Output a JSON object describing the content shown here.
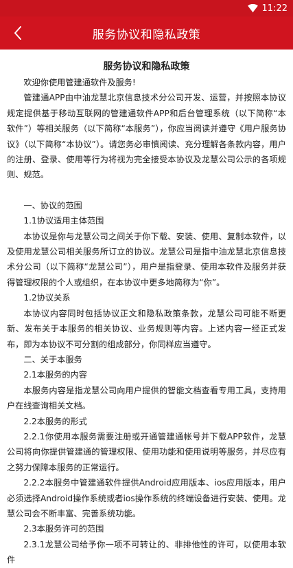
{
  "status_bar": {
    "time": "11:22"
  },
  "header": {
    "title": "服务协议和隐私政策"
  },
  "doc": {
    "title": "服务协议和隐私政策",
    "paragraphs": [
      "欢迎你使用管建通软件及服务!",
      "管建通APP由中油龙慧北京信息技术分公司开发、运营，并按照本协议规定提供基于移动互联网的管建通软件APP和后台管理系统（以下简称“本软件”）等相关服务（以下简称“本服务”），你应当阅读并遵守《用户服务协议》（以下简称“本协议”）。请您务必审慎阅读、充分理解各条款内容，用户的注册、登录、使用等行为将视为完全接受本协议及龙慧公司公示的各项规则、规范。",
      "一、协议的范围",
      "1.1协议适用主体范围",
      "本协议是你与龙慧公司之间关于你下载、安装、使用、复制本软件，以及使用龙慧公司相关服务所订立的协议。龙慧公司是指中油龙慧北京信息技术分公司（以下简称“龙慧公司”），用户是指登录、使用本软件及服务并获得管理权限的个人或组织，在本协议中更多地简称为“你”。",
      "1.2协议关系",
      "本协议内容同时包括协议正文和隐私政策条款，龙慧公司可能不断更新、发布关于本服务的相关协议、业务规则等内容。上述内容一经正式发布，即为本协议不可分割的组成部分，你同样应当遵守。",
      "二、关于本服务",
      "2.1本服务的内容",
      "本服务内容是指龙慧公司向用户提供的智能文档查看专用工具，支持用户在线查询相关文档。",
      "2.2本服务的形式",
      "2.2.1你使用本服务需要注册或开通管建通帐号并下载APP软件，龙慧公司将向你提供管建通的管理权限、使用功能和使用说明等服务，并尽应有之努力保障本服务的正常运行。",
      "2.2.2本服务中管建通软件提供Android应用版本、ios应用版本，用户必须选择Android操作系统或者ios操作系统的终端设备进行安装、使用。龙慧公司会不断丰富、完善系统功能。",
      "2.3本服务许可的范围",
      "2.3.1龙慧公司给予你一项不可转让的、非排他性的许可，以使用本软件"
    ]
  }
}
